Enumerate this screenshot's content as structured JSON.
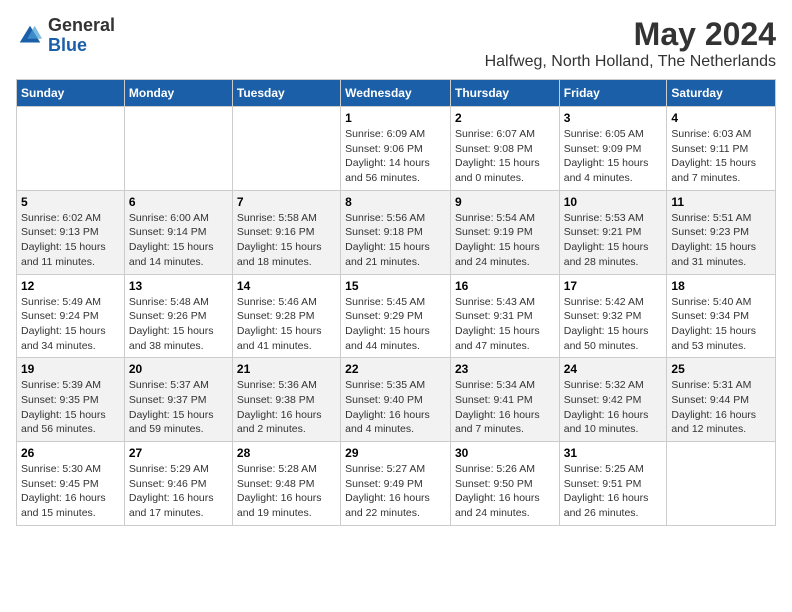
{
  "header": {
    "logo_general": "General",
    "logo_blue": "Blue",
    "month_title": "May 2024",
    "location": "Halfweg, North Holland, The Netherlands"
  },
  "days_of_week": [
    "Sunday",
    "Monday",
    "Tuesday",
    "Wednesday",
    "Thursday",
    "Friday",
    "Saturday"
  ],
  "weeks": [
    [
      {
        "day": "",
        "info": ""
      },
      {
        "day": "",
        "info": ""
      },
      {
        "day": "",
        "info": ""
      },
      {
        "day": "1",
        "info": "Sunrise: 6:09 AM\nSunset: 9:06 PM\nDaylight: 14 hours\nand 56 minutes."
      },
      {
        "day": "2",
        "info": "Sunrise: 6:07 AM\nSunset: 9:08 PM\nDaylight: 15 hours\nand 0 minutes."
      },
      {
        "day": "3",
        "info": "Sunrise: 6:05 AM\nSunset: 9:09 PM\nDaylight: 15 hours\nand 4 minutes."
      },
      {
        "day": "4",
        "info": "Sunrise: 6:03 AM\nSunset: 9:11 PM\nDaylight: 15 hours\nand 7 minutes."
      }
    ],
    [
      {
        "day": "5",
        "info": "Sunrise: 6:02 AM\nSunset: 9:13 PM\nDaylight: 15 hours\nand 11 minutes."
      },
      {
        "day": "6",
        "info": "Sunrise: 6:00 AM\nSunset: 9:14 PM\nDaylight: 15 hours\nand 14 minutes."
      },
      {
        "day": "7",
        "info": "Sunrise: 5:58 AM\nSunset: 9:16 PM\nDaylight: 15 hours\nand 18 minutes."
      },
      {
        "day": "8",
        "info": "Sunrise: 5:56 AM\nSunset: 9:18 PM\nDaylight: 15 hours\nand 21 minutes."
      },
      {
        "day": "9",
        "info": "Sunrise: 5:54 AM\nSunset: 9:19 PM\nDaylight: 15 hours\nand 24 minutes."
      },
      {
        "day": "10",
        "info": "Sunrise: 5:53 AM\nSunset: 9:21 PM\nDaylight: 15 hours\nand 28 minutes."
      },
      {
        "day": "11",
        "info": "Sunrise: 5:51 AM\nSunset: 9:23 PM\nDaylight: 15 hours\nand 31 minutes."
      }
    ],
    [
      {
        "day": "12",
        "info": "Sunrise: 5:49 AM\nSunset: 9:24 PM\nDaylight: 15 hours\nand 34 minutes."
      },
      {
        "day": "13",
        "info": "Sunrise: 5:48 AM\nSunset: 9:26 PM\nDaylight: 15 hours\nand 38 minutes."
      },
      {
        "day": "14",
        "info": "Sunrise: 5:46 AM\nSunset: 9:28 PM\nDaylight: 15 hours\nand 41 minutes."
      },
      {
        "day": "15",
        "info": "Sunrise: 5:45 AM\nSunset: 9:29 PM\nDaylight: 15 hours\nand 44 minutes."
      },
      {
        "day": "16",
        "info": "Sunrise: 5:43 AM\nSunset: 9:31 PM\nDaylight: 15 hours\nand 47 minutes."
      },
      {
        "day": "17",
        "info": "Sunrise: 5:42 AM\nSunset: 9:32 PM\nDaylight: 15 hours\nand 50 minutes."
      },
      {
        "day": "18",
        "info": "Sunrise: 5:40 AM\nSunset: 9:34 PM\nDaylight: 15 hours\nand 53 minutes."
      }
    ],
    [
      {
        "day": "19",
        "info": "Sunrise: 5:39 AM\nSunset: 9:35 PM\nDaylight: 15 hours\nand 56 minutes."
      },
      {
        "day": "20",
        "info": "Sunrise: 5:37 AM\nSunset: 9:37 PM\nDaylight: 15 hours\nand 59 minutes."
      },
      {
        "day": "21",
        "info": "Sunrise: 5:36 AM\nSunset: 9:38 PM\nDaylight: 16 hours\nand 2 minutes."
      },
      {
        "day": "22",
        "info": "Sunrise: 5:35 AM\nSunset: 9:40 PM\nDaylight: 16 hours\nand 4 minutes."
      },
      {
        "day": "23",
        "info": "Sunrise: 5:34 AM\nSunset: 9:41 PM\nDaylight: 16 hours\nand 7 minutes."
      },
      {
        "day": "24",
        "info": "Sunrise: 5:32 AM\nSunset: 9:42 PM\nDaylight: 16 hours\nand 10 minutes."
      },
      {
        "day": "25",
        "info": "Sunrise: 5:31 AM\nSunset: 9:44 PM\nDaylight: 16 hours\nand 12 minutes."
      }
    ],
    [
      {
        "day": "26",
        "info": "Sunrise: 5:30 AM\nSunset: 9:45 PM\nDaylight: 16 hours\nand 15 minutes."
      },
      {
        "day": "27",
        "info": "Sunrise: 5:29 AM\nSunset: 9:46 PM\nDaylight: 16 hours\nand 17 minutes."
      },
      {
        "day": "28",
        "info": "Sunrise: 5:28 AM\nSunset: 9:48 PM\nDaylight: 16 hours\nand 19 minutes."
      },
      {
        "day": "29",
        "info": "Sunrise: 5:27 AM\nSunset: 9:49 PM\nDaylight: 16 hours\nand 22 minutes."
      },
      {
        "day": "30",
        "info": "Sunrise: 5:26 AM\nSunset: 9:50 PM\nDaylight: 16 hours\nand 24 minutes."
      },
      {
        "day": "31",
        "info": "Sunrise: 5:25 AM\nSunset: 9:51 PM\nDaylight: 16 hours\nand 26 minutes."
      },
      {
        "day": "",
        "info": ""
      }
    ]
  ]
}
